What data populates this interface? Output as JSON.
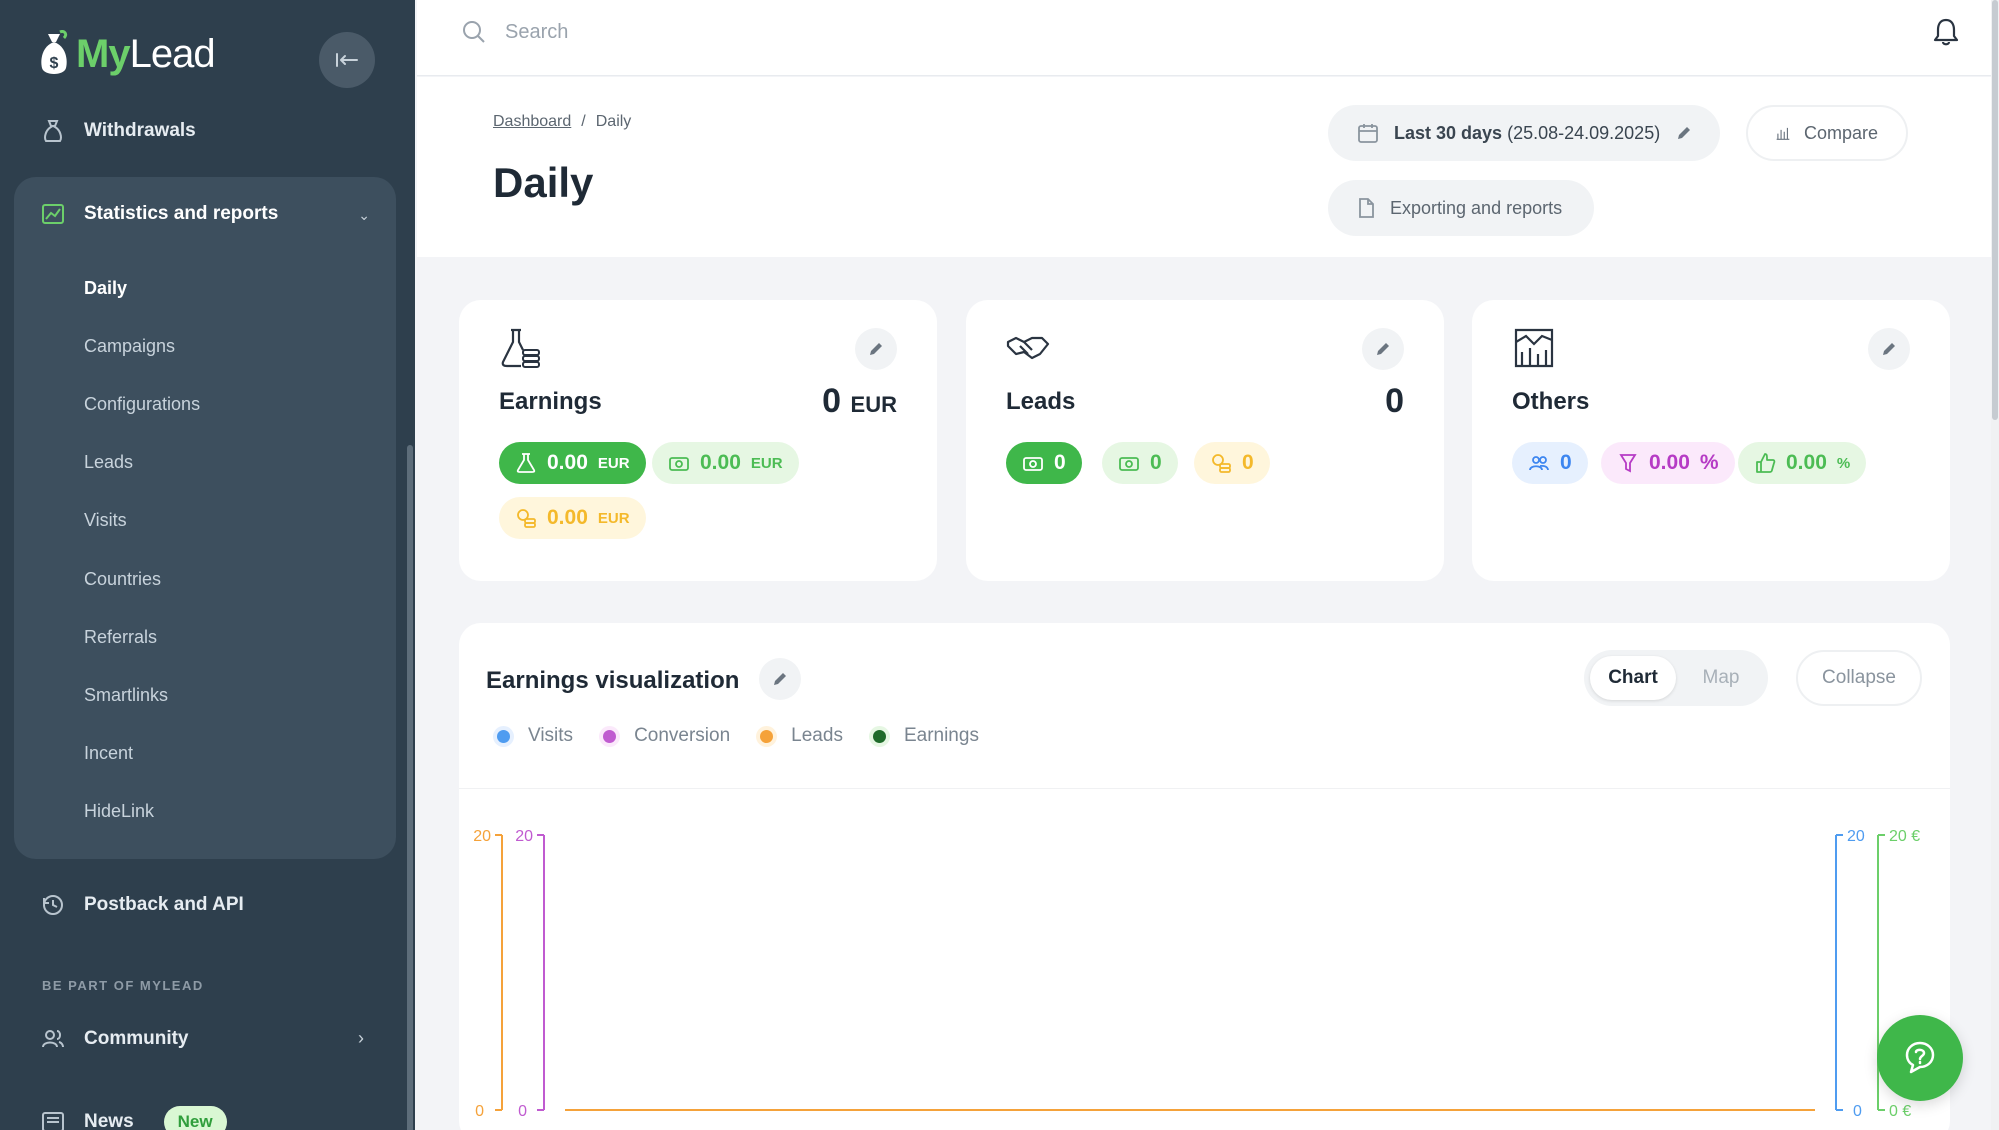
{
  "app": {
    "logo_text_a": "My",
    "logo_text_b": "Lead"
  },
  "sidebar": {
    "withdrawals": "Withdrawals",
    "stats_group_label": "Statistics and reports",
    "sub_items": [
      "Daily",
      "Campaigns",
      "Configurations",
      "Leads",
      "Visits",
      "Countries",
      "Referrals",
      "Smartlinks",
      "Incent",
      "HideLink"
    ],
    "postback": "Postback and API",
    "section_label": "BE PART OF MYLEAD",
    "community": "Community",
    "news": "News",
    "news_badge": "New"
  },
  "search": {
    "placeholder": "Search"
  },
  "header": {
    "breadcrumb_root": "Dashboard",
    "breadcrumb_sep": "/",
    "breadcrumb_current": "Daily",
    "title": "Daily",
    "date_range_bold": "Last 30 days",
    "date_range_value": "(25.08-24.09.2025)",
    "compare": "Compare",
    "export": "Exporting and reports"
  },
  "cards": {
    "earnings": {
      "name": "Earnings",
      "total": "0",
      "total_unit": "EUR",
      "chip1_value": "0.00",
      "chip1_unit": "EUR",
      "chip2_value": "0.00",
      "chip2_unit": "EUR",
      "chip3_value": "0.00",
      "chip3_unit": "EUR"
    },
    "leads": {
      "name": "Leads",
      "total": "0",
      "chip1_value": "0",
      "chip2_value": "0",
      "chip3_value": "0"
    },
    "others": {
      "name": "Others",
      "chip1_value": "0",
      "chip2_value": "0.00",
      "chip2_unit": "%",
      "chip3_value": "0.00",
      "chip3_unit": "%"
    }
  },
  "chart_section": {
    "title": "Earnings visualization",
    "toggle_chart": "Chart",
    "toggle_map": "Map",
    "collapse": "Collapse",
    "legend": [
      "Visits",
      "Conversion",
      "Leads",
      "Earnings"
    ]
  },
  "chart_data": {
    "type": "line",
    "series": [
      {
        "name": "Visits",
        "color": "#4f9cf0",
        "values": []
      },
      {
        "name": "Conversion",
        "color": "#c05bd0",
        "values": []
      },
      {
        "name": "Leads",
        "color": "#f5a23a",
        "values": []
      },
      {
        "name": "Earnings",
        "color": "#1f6b2a",
        "values": []
      }
    ],
    "axes": [
      {
        "side": "left-outer",
        "color": "#f5a23a",
        "ticks": [
          "20",
          "0"
        ],
        "ylim": [
          0,
          20
        ]
      },
      {
        "side": "left-inner",
        "color": "#c05bd0",
        "ticks": [
          "20",
          "0"
        ],
        "ylim": [
          0,
          20
        ]
      },
      {
        "side": "right-inner",
        "color": "#4f9cf0",
        "ticks": [
          "20",
          "0"
        ],
        "ylim": [
          0,
          20
        ]
      },
      {
        "side": "right-outer",
        "color": "#6ccf6a",
        "ticks": [
          "20 €",
          "0 €"
        ],
        "ylim": [
          0,
          20
        ]
      }
    ],
    "baseline_color": "#f5a23a"
  },
  "colors": {
    "sidebar_bg": "#2e3f4d",
    "accent_green": "#3fb74a",
    "brand_green": "#6ccf6a"
  }
}
